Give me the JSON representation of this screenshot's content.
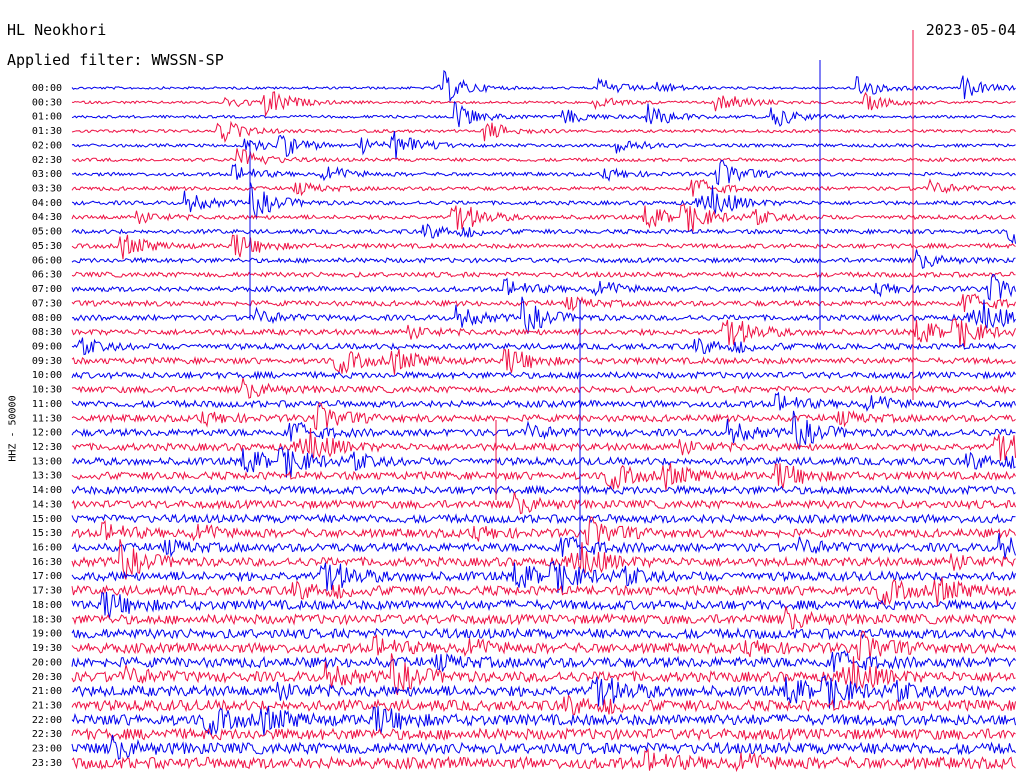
{
  "header": {
    "station": "HL Neokhori",
    "filter_label": "Applied filter: WWSSN-SP",
    "date": "2023-05-04"
  },
  "chart_data": {
    "type": "line",
    "title": "HL Neokhori",
    "subtitle": "Applied filter: WWSSN-SP",
    "ylabel": "HHZ - 50000",
    "xlabel": "",
    "row_labels": [
      "00:00",
      "00:30",
      "01:00",
      "01:30",
      "02:00",
      "02:30",
      "03:00",
      "03:30",
      "04:00",
      "04:30",
      "05:00",
      "05:30",
      "06:00",
      "06:30",
      "07:00",
      "07:30",
      "08:00",
      "08:30",
      "09:00",
      "09:30",
      "10:00",
      "10:30",
      "11:00",
      "11:30",
      "12:00",
      "12:30",
      "13:00",
      "13:30",
      "14:00",
      "14:30",
      "15:00",
      "15:30",
      "16:00",
      "16:30",
      "17:00",
      "17:30",
      "18:00",
      "18:30",
      "19:00",
      "19:30",
      "20:00",
      "20:30",
      "21:00",
      "21:30",
      "22:00",
      "22:30",
      "23:00",
      "23:30"
    ],
    "series_colors": [
      "#0000ee",
      "#ee1144"
    ],
    "grid": false,
    "legend": "none"
  }
}
